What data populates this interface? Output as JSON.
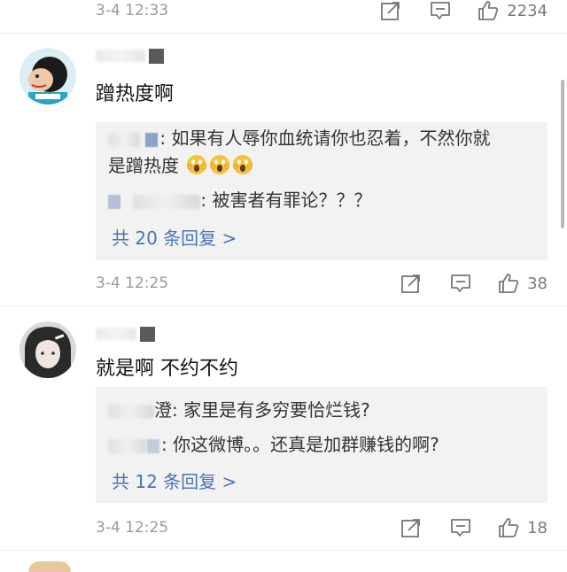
{
  "top_row": {
    "time": "3-4 12:33",
    "likes": "2234"
  },
  "comments": [
    {
      "text": "蹭热度啊",
      "replies": [
        {
          "name_visible": "",
          "text": ": 如果有人辱你血统请你也忍着，不然你就",
          "text2": "是蹭热度",
          "emoji_names": [
            "scream-emoji",
            "scream-emoji",
            "scream-emoji"
          ]
        },
        {
          "name_visible": "",
          "text": ": 被害者有罪论？？？"
        }
      ],
      "more": "共 20 条回复 >",
      "time": "3-4 12:25",
      "likes": "38"
    },
    {
      "text": "就是啊 不约不约",
      "replies": [
        {
          "name_visible": "澄",
          "text": ": 家里是有多穷要恰烂钱?"
        },
        {
          "name_visible": "",
          "text": ": 你这微博。。还真是加群赚钱的啊?"
        }
      ],
      "more": "共 12 条回复 >",
      "time": "3-4 12:25",
      "likes": "18"
    }
  ],
  "colors": {
    "link": "#4a74b4",
    "meta": "#9a9a9a",
    "reply_bg": "#f2f2f2"
  },
  "icons": [
    "share-icon",
    "comment-icon",
    "like-icon"
  ]
}
